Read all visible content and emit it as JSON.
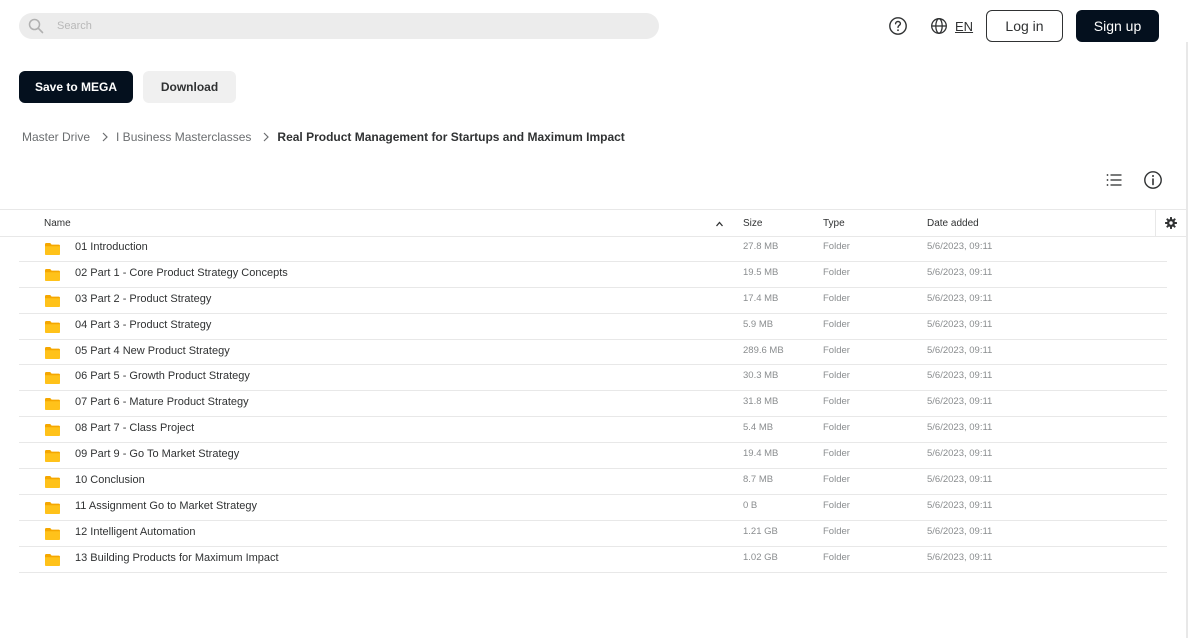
{
  "search": {
    "placeholder": "Search",
    "value": ""
  },
  "header": {
    "language": "EN",
    "login_label": "Log in",
    "signup_label": "Sign up"
  },
  "actions": {
    "save_label": "Save to MEGA",
    "download_label": "Download"
  },
  "breadcrumb": [
    "Master Drive",
    "I Business Masterclasses",
    "Real Product Management for Startups and Maximum Impact"
  ],
  "table": {
    "columns": {
      "name": "Name",
      "size": "Size",
      "type": "Type",
      "date": "Date added"
    },
    "rows": [
      {
        "name": "01 Introduction",
        "size": "27.8 MB",
        "type": "Folder",
        "date": "5/6/2023, 09:11"
      },
      {
        "name": "02 Part 1 - Core Product Strategy Concepts",
        "size": "19.5 MB",
        "type": "Folder",
        "date": "5/6/2023, 09:11"
      },
      {
        "name": "03 Part 2 - Product Strategy",
        "size": "17.4 MB",
        "type": "Folder",
        "date": "5/6/2023, 09:11"
      },
      {
        "name": "04 Part 3 - Product Strategy",
        "size": "5.9 MB",
        "type": "Folder",
        "date": "5/6/2023, 09:11"
      },
      {
        "name": "05 Part 4 New Product Strategy",
        "size": "289.6 MB",
        "type": "Folder",
        "date": "5/6/2023, 09:11"
      },
      {
        "name": "06 Part 5 - Growth Product Strategy",
        "size": "30.3 MB",
        "type": "Folder",
        "date": "5/6/2023, 09:11"
      },
      {
        "name": "07 Part 6 - Mature Product Strategy",
        "size": "31.8 MB",
        "type": "Folder",
        "date": "5/6/2023, 09:11"
      },
      {
        "name": "08 Part 7 - Class Project",
        "size": "5.4 MB",
        "type": "Folder",
        "date": "5/6/2023, 09:11"
      },
      {
        "name": "09 Part 9 - Go To Market Strategy",
        "size": "19.4 MB",
        "type": "Folder",
        "date": "5/6/2023, 09:11"
      },
      {
        "name": "10 Conclusion",
        "size": "8.7 MB",
        "type": "Folder",
        "date": "5/6/2023, 09:11"
      },
      {
        "name": "11 Assignment Go to Market Strategy",
        "size": "0 B",
        "type": "Folder",
        "date": "5/6/2023, 09:11"
      },
      {
        "name": "12 Intelligent Automation",
        "size": "1.21 GB",
        "type": "Folder",
        "date": "5/6/2023, 09:11"
      },
      {
        "name": "13 Building Products for Maximum Impact",
        "size": "1.02 GB",
        "type": "Folder",
        "date": "5/6/2023, 09:11"
      }
    ]
  },
  "icons": {
    "search": "search-icon",
    "help": "help-icon",
    "language": "globe-icon",
    "breadcrumb_separator": "chevron-right-icon",
    "list_view": "list-view-icon",
    "info": "info-icon",
    "sort": "sort-ascending-icon",
    "settings": "gear-icon",
    "folder": "folder-icon"
  },
  "colors": {
    "primary_dark": "#04101e",
    "folder": "#ffbf00",
    "text": "#303233",
    "muted": "#8a8d8f",
    "search_bg": "#ececec"
  }
}
